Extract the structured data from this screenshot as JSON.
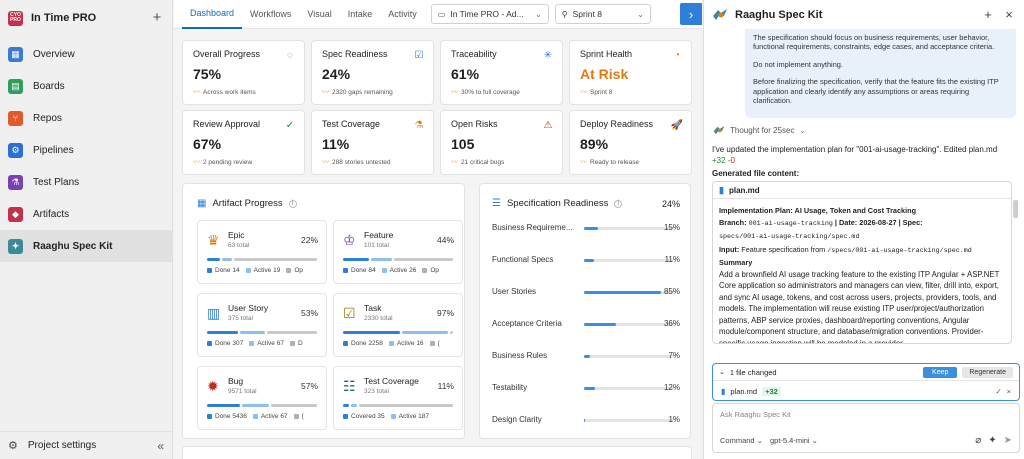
{
  "sidebar": {
    "project_logo": "CYO PRO",
    "project_name": "In Time PRO",
    "items": [
      {
        "label": "Overview",
        "icon": "overview-icon",
        "color": "#3a7bd5"
      },
      {
        "label": "Boards",
        "icon": "boards-icon",
        "color": "#2e9e5b"
      },
      {
        "label": "Repos",
        "icon": "repos-icon",
        "color": "#e05a2b"
      },
      {
        "label": "Pipelines",
        "icon": "pipelines-icon",
        "color": "#2c6fd6"
      },
      {
        "label": "Test Plans",
        "icon": "test-plans-icon",
        "color": "#7b3fb5"
      },
      {
        "label": "Artifacts",
        "icon": "artifacts-icon",
        "color": "#c4314b"
      },
      {
        "label": "Raaghu Spec Kit",
        "icon": "spec-kit-icon",
        "color": "#3a8a9a"
      }
    ],
    "settings_label": "Project settings"
  },
  "topbar": {
    "tabs": [
      "Dashboard",
      "Workflows",
      "Visual",
      "Intake",
      "Activity"
    ],
    "project_select": "In Time PRO - Ad...",
    "sprint_select": "Sprint 8"
  },
  "cards": [
    {
      "title": "Overall Progress",
      "value": "75%",
      "sub": "Across work items",
      "icon": "progress-ring-icon",
      "accent": "#2f7fd8"
    },
    {
      "title": "Spec Readiness",
      "value": "24%",
      "sub": "2320 gaps remaining",
      "icon": "checklist-icon",
      "accent": "#2f7fd8"
    },
    {
      "title": "Traceability",
      "value": "61%",
      "sub": "30% to full coverage",
      "icon": "network-icon",
      "accent": "#2f7fd8"
    },
    {
      "title": "Sprint Health",
      "value": "At Risk",
      "sub": "Sprint 8",
      "icon": "gauge-icon",
      "accent": "#e07a13"
    },
    {
      "title": "Review Approval",
      "value": "67%",
      "sub": "2 pending review",
      "icon": "check-circle-icon",
      "accent": "#188a3a"
    },
    {
      "title": "Test Coverage",
      "value": "11%",
      "sub": "288 stories untested",
      "icon": "flask-icon",
      "accent": "#e07a13"
    },
    {
      "title": "Open Risks",
      "value": "105",
      "sub": "21 critical bugs",
      "icon": "warning-icon",
      "accent": "#c42b1c"
    },
    {
      "title": "Deploy Readiness",
      "value": "89%",
      "sub": "Ready to release",
      "icon": "rocket-icon",
      "accent": "#188a3a"
    }
  ],
  "artifact_progress": {
    "title": "Artifact Progress",
    "items": [
      {
        "name": "Epic",
        "total": "63 total",
        "pct": "22%",
        "progress": 0.22,
        "icon": "crown-icon",
        "legend": [
          "Done 14",
          "Active 19",
          "Op"
        ]
      },
      {
        "name": "Feature",
        "total": "101 total",
        "pct": "44%",
        "progress": 0.44,
        "icon": "trophy-icon",
        "legend": [
          "Done 84",
          "Active 26",
          "Op"
        ]
      },
      {
        "name": "User Story",
        "total": "375 total",
        "pct": "53%",
        "progress": 0.53,
        "icon": "book-icon",
        "legend": [
          "Done 307",
          "Active 67",
          "D"
        ]
      },
      {
        "name": "Task",
        "total": "2330 total",
        "pct": "97%",
        "progress": 0.97,
        "icon": "task-icon",
        "legend": [
          "Done 2258",
          "Active 16",
          "("
        ]
      },
      {
        "name": "Bug",
        "total": "9571 total",
        "pct": "57%",
        "progress": 0.57,
        "icon": "bug-icon",
        "legend": [
          "Done 5436",
          "Active 67",
          "("
        ]
      },
      {
        "name": "Test Coverage",
        "total": "323 total",
        "pct": "11%",
        "progress": 0.11,
        "icon": "test-case-icon",
        "legend": [
          "Covered 35",
          "Active 187",
          ""
        ]
      }
    ]
  },
  "spec_readiness": {
    "title": "Specification Readiness",
    "overall": "24%",
    "rows": [
      {
        "label": "Business Requireme...",
        "pct": "15%",
        "value": 0.15
      },
      {
        "label": "Functional Specs",
        "pct": "11%",
        "value": 0.11
      },
      {
        "label": "User Stories",
        "pct": "85%",
        "value": 0.85
      },
      {
        "label": "Acceptance Criteria",
        "pct": "36%",
        "value": 0.36
      },
      {
        "label": "Business Rules",
        "pct": "7%",
        "value": 0.07
      },
      {
        "label": "Testability",
        "pct": "12%",
        "value": 0.12
      },
      {
        "label": "Design Clarity",
        "pct": "1%",
        "value": 0.01
      }
    ]
  },
  "chat": {
    "title": "Raaghu Spec Kit",
    "user_message": [
      "The specification should focus on business requirements, user behavior, functional requirements, constraints, edge cases, and acceptance criteria.",
      "Do not implement anything.",
      "Before finalizing the specification, verify that the feature fits the existing ITP application and clearly identify any assumptions or areas requiring clarification."
    ],
    "thought": "Thought for 25sec",
    "response_prefix": "I've updated the implementation plan for \"001-ai-usage-tracking\". Edited plan.md",
    "added": "+32",
    "removed": "-0",
    "generated_label": "Generated file content:",
    "file_name": "plan.md",
    "file_heading": "Implementation Plan: AI Usage, Token and Cost Tracking",
    "branch_label": "Branch:",
    "branch_value": "001-ai-usage-tracking",
    "date_label": "| Date: 2026-08-27 | Spec:",
    "spec_path": "specs/001-ai-usage-tracking/spec.md",
    "input_label": "Input:",
    "input_text": "Feature specification from",
    "input_path": "/specs/001-ai-usage-tracking/spec.md",
    "summary_label": "Summary",
    "summary_text": "Add a brownfield AI usage tracking feature to the existing ITP Angular + ASP.NET Core application so administrators and managers can view, filter, drill into, export, and sync AI usage, tokens, and cost across users, projects, providers, tools, and models. The implementation will reuse existing ITP user/project/authorization patterns, ABP service proxies, dashboard/reporting conventions, Angular module/component structure, and database/migration conventions. Provider-specific usage ingestion will be modeled in a provider",
    "changes_label": "1 file changed",
    "keep_label": "Keep",
    "regenerate_label": "Regenerate",
    "changed_file": "plan.md",
    "changed_add": "+32",
    "input_placeholder": "Ask Raaghu Spec Kit",
    "mode_label": "Command",
    "model_label": "gpt-5.4-mini"
  }
}
